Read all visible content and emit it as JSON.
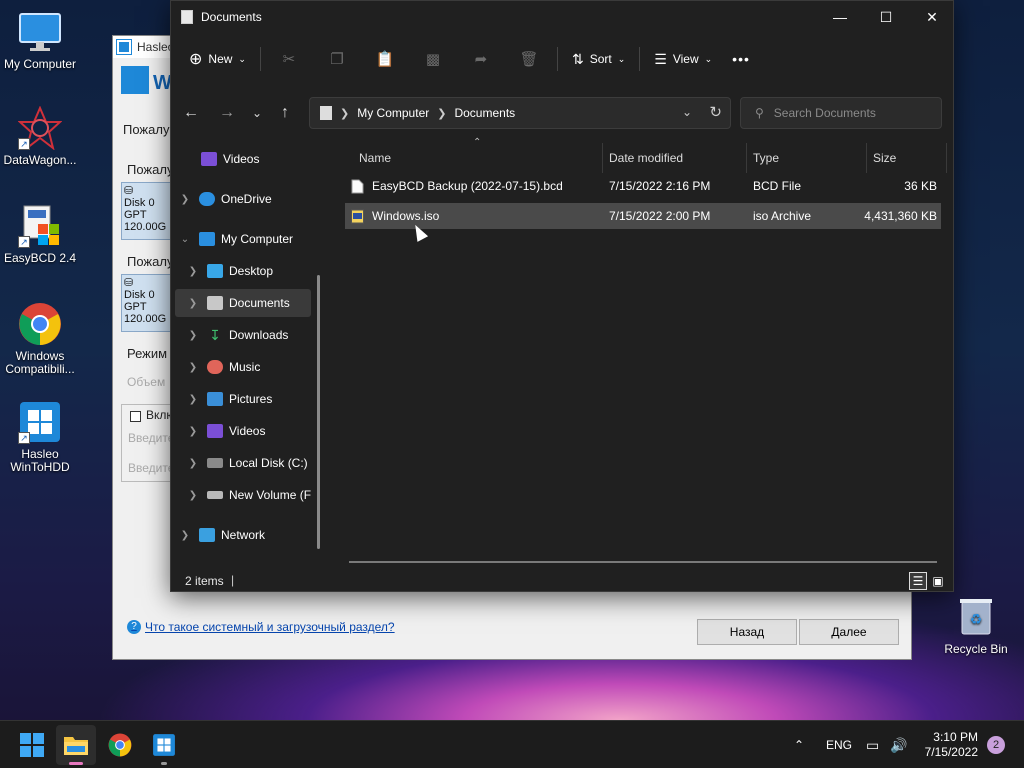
{
  "desktop": {
    "icons": [
      {
        "label": "My Computer"
      },
      {
        "label": "DataWagon..."
      },
      {
        "label": "EasyBCD 2.4"
      },
      {
        "label": "Windows Compatibili..."
      },
      {
        "label": "Hasleo WinToHDD"
      }
    ],
    "recycle_bin": "Recycle Bin"
  },
  "hasleo": {
    "title": "Hasleo",
    "header": "W",
    "label1": "Пожалуй",
    "label2": "Пожалу",
    "label3": "Пожалу",
    "disk1": {
      "line1": "Disk 0",
      "line2": "GPT",
      "line3": "120.00G"
    },
    "disk2": {
      "line1": "Disk 0",
      "line2": "GPT",
      "line3": "120.00G"
    },
    "mode_label": "Режим у",
    "volume_label": "Объем",
    "checkbox_label": "Вклю",
    "input1_placeholder": "Введите",
    "input2_placeholder": "Введите",
    "help_link": "Что такое  системный и загрузочный раздел?",
    "back_button": "Назад",
    "next_button": "Далее"
  },
  "explorer": {
    "title": "Documents",
    "toolbar": {
      "new": "New",
      "sort": "Sort",
      "view": "View",
      "more": "•••"
    },
    "address": {
      "root": "My Computer",
      "current": "Documents"
    },
    "search_placeholder": "Search Documents",
    "nav": [
      {
        "label": "Videos"
      },
      {
        "label": "OneDrive"
      },
      {
        "label": "My Computer"
      },
      {
        "label": "Desktop"
      },
      {
        "label": "Documents"
      },
      {
        "label": "Downloads"
      },
      {
        "label": "Music"
      },
      {
        "label": "Pictures"
      },
      {
        "label": "Videos"
      },
      {
        "label": "Local Disk (C:)"
      },
      {
        "label": "New Volume (F"
      },
      {
        "label": "Network"
      }
    ],
    "columns": {
      "name": "Name",
      "date": "Date modified",
      "type": "Type",
      "size": "Size"
    },
    "files": [
      {
        "name": "EasyBCD Backup (2022-07-15).bcd",
        "date": "7/15/2022 2:16 PM",
        "type": "BCD File",
        "size": "36 KB"
      },
      {
        "name": "Windows.iso",
        "date": "7/15/2022 2:00 PM",
        "type": "iso Archive",
        "size": "4,431,360 KB"
      }
    ],
    "status": "2 items"
  },
  "taskbar": {
    "lang": "ENG",
    "time": "3:10 PM",
    "date": "7/15/2022",
    "notifications": "2"
  }
}
